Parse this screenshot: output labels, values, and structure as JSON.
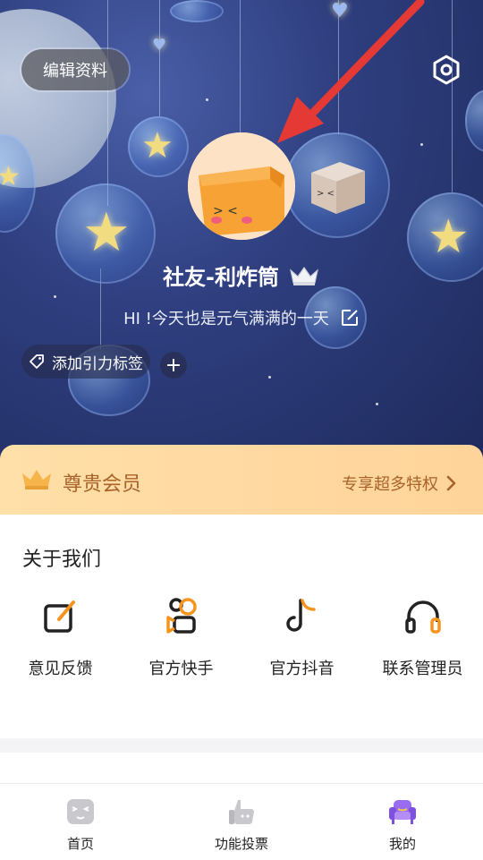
{
  "header": {
    "edit_profile_label": "编辑资料",
    "nickname": "社友-利炸筒",
    "bio": "HI !今天也是元气满满的一天",
    "add_tag_label": "添加引力标签",
    "add_tag_plus": "+"
  },
  "vip": {
    "title": "尊贵会员",
    "link_label": "专享超多特权"
  },
  "about": {
    "title": "关于我们",
    "items": [
      {
        "label": "意见反馈",
        "icon": "feedback-edit-icon"
      },
      {
        "label": "官方快手",
        "icon": "kuaishou-icon"
      },
      {
        "label": "官方抖音",
        "icon": "douyin-icon"
      },
      {
        "label": "联系管理员",
        "icon": "headset-icon"
      }
    ]
  },
  "nav": {
    "items": [
      {
        "label": "首页",
        "icon": "home-face-icon"
      },
      {
        "label": "功能投票",
        "icon": "thumbs-up-icon"
      },
      {
        "label": "我的",
        "icon": "sofa-icon",
        "active": true
      }
    ]
  },
  "colors": {
    "accent_orange": "#f7941d",
    "vip_text": "#a8632a",
    "hero_bg": "#2f3f80",
    "annotation_arrow": "#e53935"
  }
}
